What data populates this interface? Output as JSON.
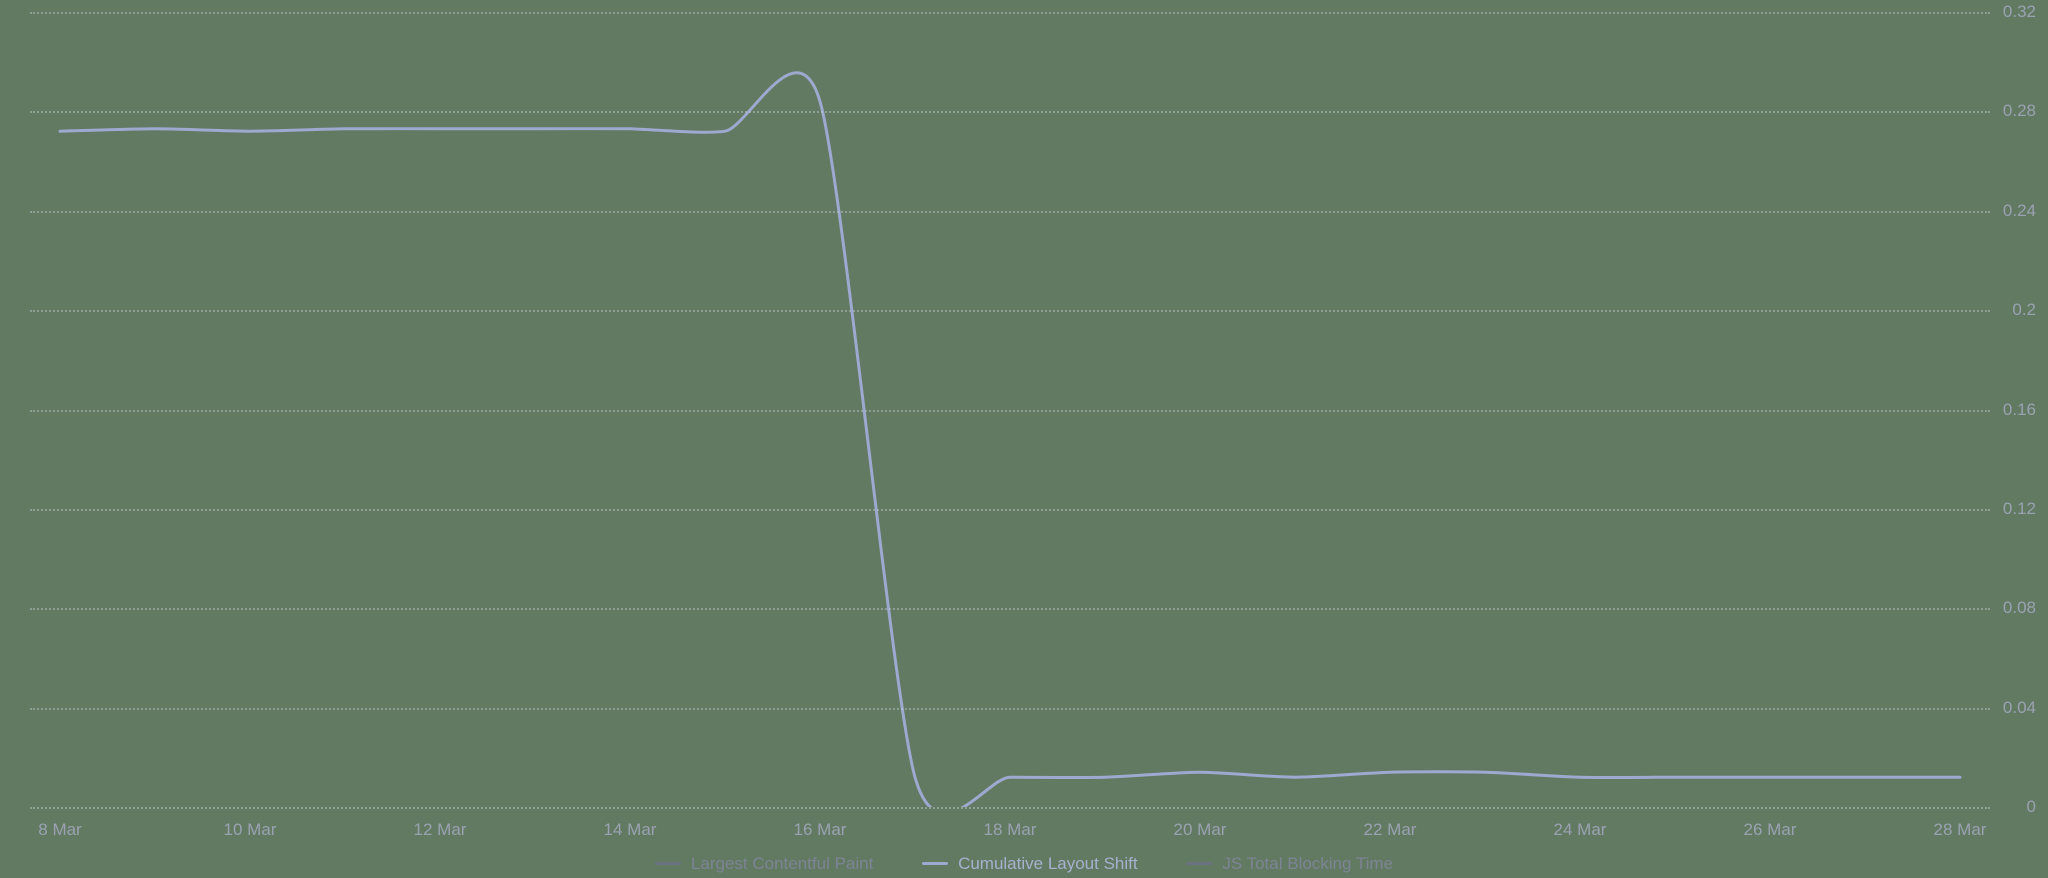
{
  "chart_data": {
    "type": "line",
    "xlabel": "",
    "ylabel": "",
    "ylim": [
      0,
      0.32
    ],
    "y_ticks": [
      0,
      0.04,
      0.08,
      0.12,
      0.16,
      0.2,
      0.24,
      0.28,
      0.32
    ],
    "x_ticks": [
      "8 Mar",
      "10 Mar",
      "12 Mar",
      "14 Mar",
      "16 Mar",
      "18 Mar",
      "20 Mar",
      "22 Mar",
      "24 Mar",
      "26 Mar",
      "28 Mar"
    ],
    "categories": [
      "8 Mar",
      "9 Mar",
      "10 Mar",
      "11 Mar",
      "12 Mar",
      "13 Mar",
      "14 Mar",
      "15 Mar",
      "16 Mar",
      "17 Mar",
      "18 Mar",
      "19 Mar",
      "20 Mar",
      "21 Mar",
      "22 Mar",
      "23 Mar",
      "24 Mar",
      "25 Mar",
      "26 Mar",
      "27 Mar",
      "28 Mar"
    ],
    "series": [
      {
        "name": "Largest Contentful Paint",
        "color": "#6b7280",
        "values": null
      },
      {
        "name": "Cumulative Layout Shift",
        "color": "#9ea9cf",
        "values": [
          0.272,
          0.273,
          0.272,
          0.273,
          0.273,
          0.273,
          0.273,
          0.272,
          0.284,
          0.012,
          0.012,
          0.012,
          0.014,
          0.012,
          0.014,
          0.014,
          0.012,
          0.012,
          0.012,
          0.012,
          0.012
        ]
      },
      {
        "name": "JS Total Blocking Time",
        "color": "#6b7280",
        "values": null
      }
    ],
    "legend": {
      "items": [
        {
          "label": "Largest Contentful Paint",
          "color": "#6b7280",
          "active": false
        },
        {
          "label": "Cumulative Layout Shift",
          "color": "#9ea9cf",
          "active": true
        },
        {
          "label": "JS Total Blocking Time",
          "color": "#6b7280",
          "active": false
        }
      ]
    }
  },
  "colors": {
    "background": "#627a62",
    "grid": "rgba(200,205,215,0.45)",
    "axis_text": "#9aa2b1",
    "legend_active": "#a7b1ce",
    "legend_dim": "#7d8494"
  }
}
